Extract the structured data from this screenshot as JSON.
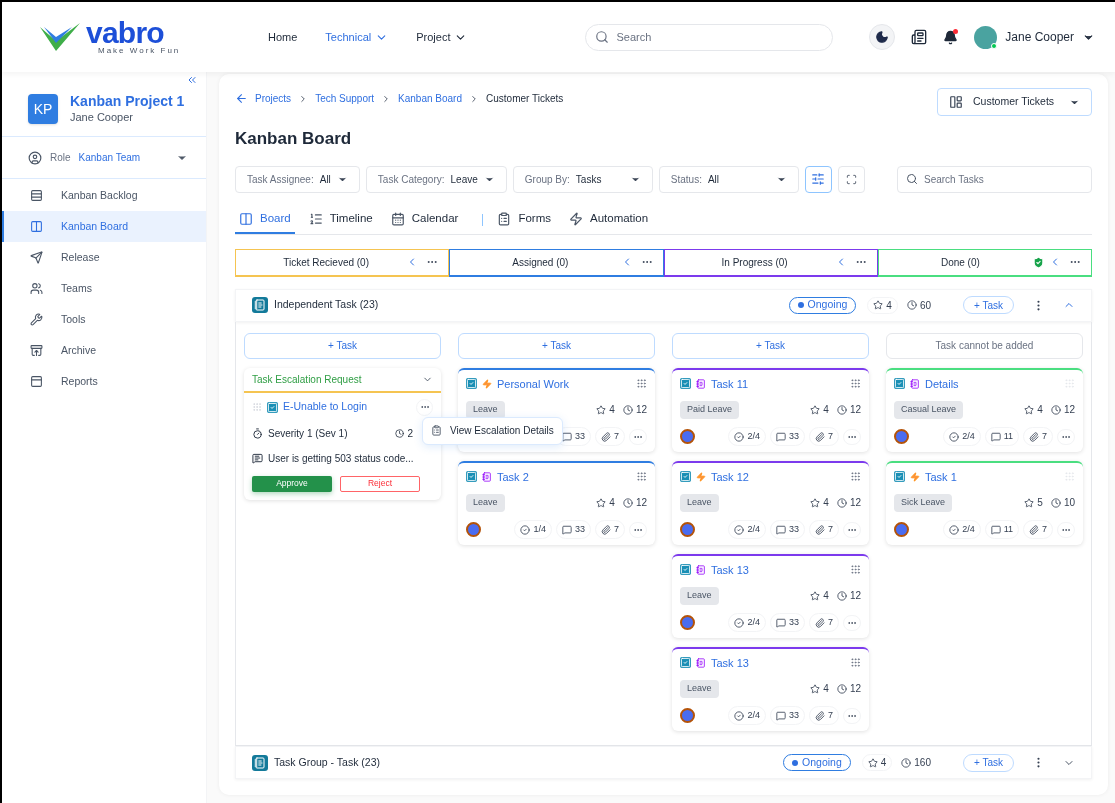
{
  "header": {
    "logo": {
      "name": "vabro",
      "tagline": "Make Work Fun"
    },
    "nav": [
      {
        "label": "Home",
        "selected": false,
        "has_menu": false
      },
      {
        "label": "Technical",
        "selected": true,
        "has_menu": true
      },
      {
        "label": "Project",
        "selected": false,
        "has_menu": true
      }
    ],
    "search": {
      "placeholder": "Search"
    },
    "notifications_unread": true,
    "user": {
      "name": "Jane Cooper",
      "online": true
    }
  },
  "sidebar": {
    "project": {
      "initials": "KP",
      "name": "Kanban Project 1",
      "owner": "Jane Cooper"
    },
    "role": {
      "label": "Role",
      "value": "Kanban Team"
    },
    "items": [
      {
        "label": "Kanban Backlog",
        "kind": "backlog",
        "selected": false
      },
      {
        "label": "Kanban Board",
        "kind": "board",
        "selected": true
      },
      {
        "label": "Release",
        "kind": "release",
        "selected": false
      },
      {
        "label": "Teams",
        "kind": "teams",
        "selected": false
      },
      {
        "label": "Tools",
        "kind": "tools",
        "selected": false
      },
      {
        "label": "Archive",
        "kind": "archive",
        "selected": false
      },
      {
        "label": "Reports",
        "kind": "reports",
        "selected": false
      }
    ]
  },
  "breadcrumb": [
    {
      "label": "Projects",
      "link": true
    },
    {
      "label": "Tech Support",
      "link": true
    },
    {
      "label": "Kanban Board",
      "link": true
    },
    {
      "label": "Customer Tickets",
      "link": false
    }
  ],
  "view_select": {
    "value": "Customer Tickets"
  },
  "title": "Kanban Board",
  "filters": [
    {
      "label": "Task Assignee:",
      "value": "All"
    },
    {
      "label": "Task Category:",
      "value": "Leave"
    },
    {
      "label": "Group By:",
      "value": "Tasks"
    },
    {
      "label": "Status:",
      "value": "All"
    }
  ],
  "filter_button": {
    "on": true
  },
  "task_search": {
    "placeholder": "Search Tasks"
  },
  "tabs": [
    {
      "label": "Board",
      "kind": "board",
      "selected": true
    },
    {
      "label": "Timeline",
      "kind": "timeline",
      "selected": false
    },
    {
      "label": "Calendar",
      "kind": "calendar",
      "selected": false
    },
    {
      "label": "Forms",
      "kind": "forms",
      "selected": false
    },
    {
      "label": "Automation",
      "kind": "automation",
      "selected": false
    }
  ],
  "columns": [
    {
      "name": "Ticket Recieved (0)",
      "color": "#f5c451",
      "verified": false
    },
    {
      "name": "Assigned (0)",
      "color": "#2f7de1",
      "verified": false
    },
    {
      "name": "In Progress (0)",
      "color": "#7c3aed",
      "verified": false
    },
    {
      "name": "Done (0)",
      "color": "#4ade80",
      "verified": true
    }
  ],
  "groups": [
    {
      "name": "Independent Task (23)",
      "status": "Ongoing",
      "stars": "4",
      "time": "60",
      "add_label": "+ Task",
      "expanded": true,
      "lanes": [
        {
          "add": {
            "label": "+ Task",
            "disabled": false
          },
          "cards": [
            {
              "kind": "escalation",
              "header": "Task Escalation Request",
              "title": "E-Unable to Login",
              "severity": "Severity 1 (Sev 1)",
              "time": "2",
              "comment": "User is getting 503 status code...",
              "approve": "Approve",
              "reject": "Reject",
              "menu": [
                {
                  "label": "View Escalation Details"
                }
              ]
            }
          ]
        },
        {
          "add": {
            "label": "+ Task",
            "disabled": false
          },
          "cards": [
            {
              "kind": "lightning",
              "title": "Personal Work",
              "tag": "Leave",
              "stars": "4",
              "time": "12",
              "comments": "33",
              "attachments": "7"
            },
            {
              "kind": "list",
              "title": "Task 2",
              "tag": "Leave",
              "stars": "4",
              "time": "12",
              "checklist": "1/4",
              "comments": "33",
              "attachments": "7"
            }
          ]
        },
        {
          "add": {
            "label": "+ Task",
            "disabled": false
          },
          "cards": [
            {
              "kind": "list",
              "title": "Task 11",
              "tag": "Paid Leave",
              "stars": "4",
              "time": "12",
              "checklist": "2/4",
              "comments": "33",
              "attachments": "7"
            },
            {
              "kind": "lightning",
              "title": "Task 12",
              "tag": "Leave",
              "stars": "4",
              "time": "12",
              "checklist": "2/4",
              "comments": "33",
              "attachments": "7"
            },
            {
              "kind": "list",
              "title": "Task 13",
              "tag": "Leave",
              "stars": "4",
              "time": "12",
              "checklist": "2/4",
              "comments": "33",
              "attachments": "7"
            },
            {
              "kind": "list",
              "title": "Task 13",
              "tag": "Leave",
              "stars": "4",
              "time": "12",
              "checklist": "2/4",
              "comments": "33",
              "attachments": "7"
            }
          ]
        },
        {
          "add": {
            "label": "Task cannot be added",
            "disabled": true
          },
          "cards": [
            {
              "kind": "list",
              "title": "Details",
              "tag": "Casual Leave",
              "stars": "4",
              "time": "12",
              "checklist": "2/4",
              "comments": "11",
              "attachments": "7"
            },
            {
              "kind": "lightning",
              "title": "Task 1",
              "tag": "Sick Leave",
              "stars": "5",
              "time": "10",
              "checklist": "2/4",
              "comments": "11",
              "attachments": "7"
            }
          ]
        }
      ]
    },
    {
      "name": "Task Group - Task (23)",
      "status": "Ongoing",
      "stars": "4",
      "time": "160",
      "add_label": "+ Task",
      "expanded": false
    }
  ]
}
